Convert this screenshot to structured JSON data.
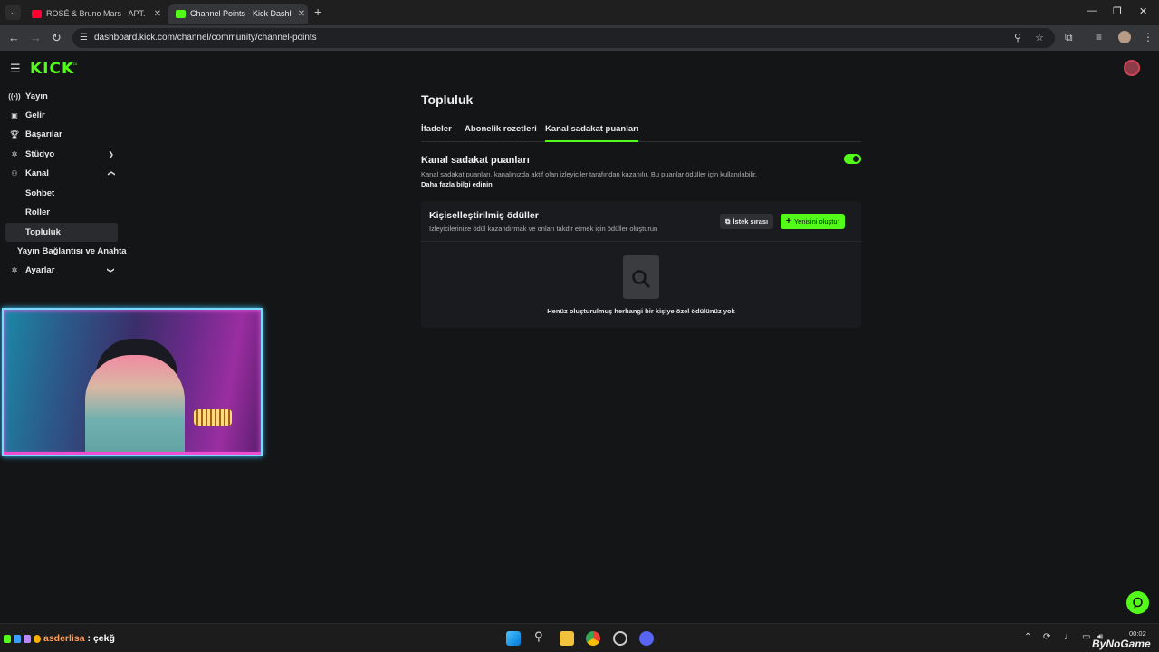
{
  "browser": {
    "tabs": [
      {
        "title": "ROSÉ & Bruno Mars - APT. (Offi",
        "close": "✕",
        "favicon_color": "#ff0033"
      },
      {
        "title": "Channel Points - Kick Dashboar",
        "close": "✕",
        "favicon_color": "#53fc18"
      }
    ],
    "new_tab": "+",
    "url": "dashboard.kick.com/channel/community/channel-points"
  },
  "header": {
    "logo": "KICK",
    "beta": "BETA"
  },
  "sidebar": {
    "items": [
      {
        "label": "Yayın",
        "icon": "broadcast-icon"
      },
      {
        "label": "Gelir",
        "icon": "wallet-icon"
      },
      {
        "label": "Başarılar",
        "icon": "trophy-icon"
      },
      {
        "label": "Stüdyo",
        "icon": "gear-icon"
      },
      {
        "label": "Kanal",
        "icon": "users-icon"
      },
      {
        "label": "Sohbet"
      },
      {
        "label": "Roller"
      },
      {
        "label": "Topluluk"
      },
      {
        "label": "Yayın Bağlantısı ve Anahtarı"
      },
      {
        "label": "Ayarlar",
        "icon": "settings-icon"
      }
    ]
  },
  "page": {
    "title": "Topluluk",
    "tabs": [
      "İfadeler",
      "Abonelik rozetleri",
      "Kanal sadakat puanları"
    ],
    "section": {
      "title": "Kanal sadakat puanları",
      "description": "Kanal sadakat puanları, kanalınızda aktif olan izleyiciler tarafından kazanılır. Bu puanlar ödüller için kullanılabilir.",
      "link": "Daha fazla bilgi edinin",
      "enabled": true
    },
    "rewards": {
      "title": "Kişiselleştirilmiş ödüller",
      "description": "İzleyicilerinize ödül kazandırmak ve onları takdir etmek için ödüller oluşturun",
      "queue_button": "İstek sırası",
      "new_button": "Yenisini oluştur",
      "empty_text": "Henüz oluşturulmuş herhangi bir kişiye özel ödülünüz yok"
    }
  },
  "taskbar": {
    "chat_user": "asderlisa",
    "chat_message": ": çekğ",
    "time": "00:02",
    "watermark": "ByNoGame"
  },
  "colors": {
    "accent": "#53fc18",
    "background": "#141517"
  }
}
